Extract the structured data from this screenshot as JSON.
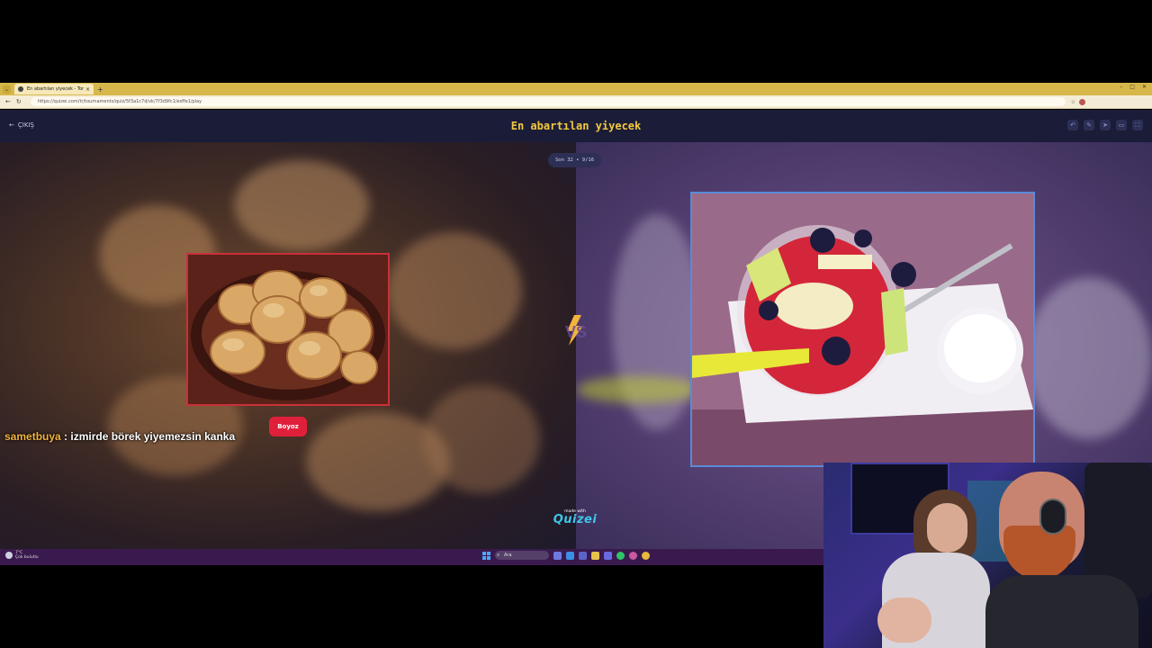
{
  "browser": {
    "tab_title": "En abartılan yiyecek - Tor Sol. Fin",
    "new_tab": "+",
    "url": "https://quizei.com/tr/tournaments/quiz/5f3a1c7d/vk/7f3d9fc1/esffe1/play",
    "colors": {
      "tabbar": "#d8b74a",
      "addressbar": "#f4ecd4"
    }
  },
  "app": {
    "exit_label": "ÇIKIŞ",
    "title": "En abartılan yiyecek",
    "round_label": "Son 32 • 9/16",
    "choose_label": "Boyoz",
    "made_with_small": "made with",
    "made_with_brand": "Quizei",
    "header_icons": [
      "undo-icon",
      "edit-icon",
      "share-icon",
      "chat-icon",
      "fullscreen-icon"
    ],
    "colors": {
      "title": "#f3c93f",
      "choose_button": "#e0203a",
      "left_border": "#c9303a",
      "right_border": "#5a8ad8",
      "brand": "#3ec6e8"
    }
  },
  "chat": {
    "username": "sametbuya",
    "separator": " : ",
    "message": "izmirde börek yiyemezsin kanka"
  },
  "taskbar": {
    "weather_temp": "7°C",
    "weather_desc": "Çok bulutlu",
    "search_placeholder": "Ara"
  }
}
